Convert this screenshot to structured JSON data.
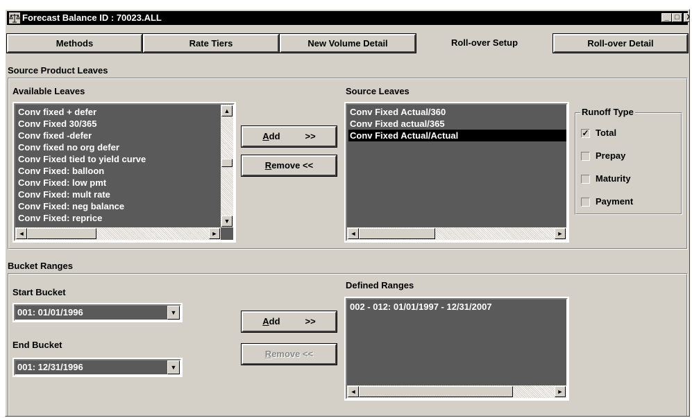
{
  "window": {
    "title": "Forecast Balance ID : 70023.ALL",
    "minimize": "_",
    "maximize": "□",
    "close": "X"
  },
  "tabs": [
    {
      "label": "Methods",
      "active": false
    },
    {
      "label": "Rate Tiers",
      "active": false
    },
    {
      "label": "New Volume Detail",
      "active": false
    },
    {
      "label": "Roll-over Setup",
      "active": true
    },
    {
      "label": "Roll-over Detail",
      "active": false
    }
  ],
  "source_product": {
    "section_title": "Source Product Leaves",
    "available_label": "Available Leaves",
    "available_items": [
      "Conv fixed + defer",
      "Conv Fixed 30/365",
      "Conv fixed -defer",
      "Conv fixed no org defer",
      "Conv Fixed tied to yield curve",
      "Conv Fixed: balloon",
      "Conv Fixed: low pmt",
      "Conv Fixed: mult rate",
      "Conv Fixed: neg balance",
      "Conv Fixed: reprice"
    ],
    "add_button": {
      "mnemonic": "A",
      "rest": "dd",
      "arrows": ">>"
    },
    "remove_button": {
      "mnemonic": "R",
      "rest": "emove <<"
    },
    "source_label": "Source Leaves",
    "source_items": [
      {
        "text": "Conv Fixed Actual/360",
        "selected": false
      },
      {
        "text": "Conv Fixed actual/365",
        "selected": false
      },
      {
        "text": "Conv Fixed Actual/Actual",
        "selected": true
      }
    ]
  },
  "runoff": {
    "title": "Runoff Type",
    "options": [
      {
        "label": "Total",
        "checked": true
      },
      {
        "label": "Prepay",
        "checked": false
      },
      {
        "label": "Maturity",
        "checked": false
      },
      {
        "label": "Payment",
        "checked": false
      }
    ]
  },
  "bucket": {
    "section_title": "Bucket Ranges",
    "start_label": "Start Bucket",
    "start_value": "001:  01/01/1996",
    "end_label": "End Bucket",
    "end_value": "001:  12/31/1996",
    "add_button": {
      "mnemonic": "A",
      "rest": "dd",
      "arrows": ">>"
    },
    "remove_button": {
      "mnemonic": "R",
      "rest": "emove <<",
      "disabled": true
    },
    "defined_label": "Defined Ranges",
    "defined_items": [
      "002 - 012:   01/01/1997 - 12/31/2007"
    ]
  }
}
